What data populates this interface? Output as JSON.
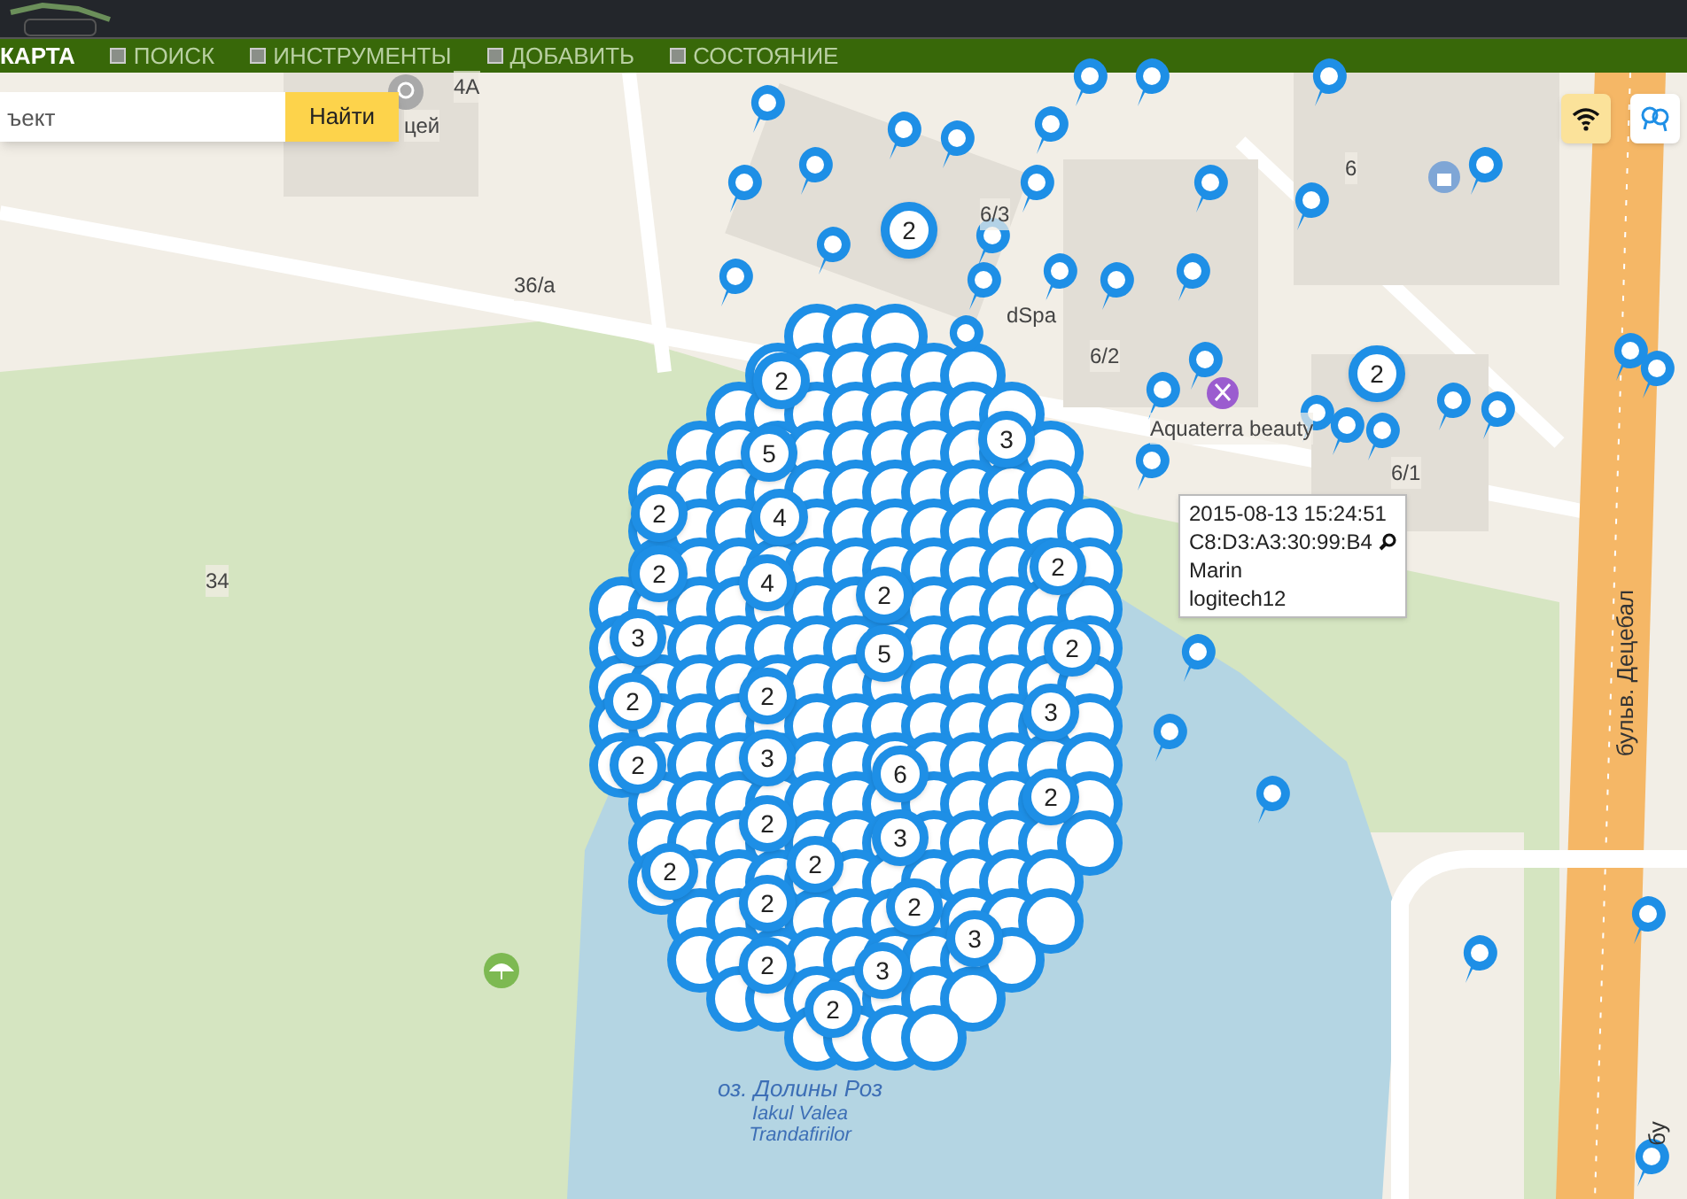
{
  "nav": [
    {
      "label": "КАРТА",
      "selected": true
    },
    {
      "label": "ПОИСК",
      "selected": false
    },
    {
      "label": "ИНСТРУМЕНТЫ",
      "selected": false
    },
    {
      "label": "ДОБАВИТЬ",
      "selected": false
    },
    {
      "label": "СОСТОЯНИЕ",
      "selected": false
    }
  ],
  "search": {
    "placeholder": "ъект",
    "button": "Найти"
  },
  "map_controls": [
    {
      "kind": "wifi",
      "selected": true
    },
    {
      "kind": "bubbles",
      "selected": false
    }
  ],
  "map_labels": [
    {
      "kind": "place",
      "text": "4A"
    },
    {
      "kind": "place",
      "text": "цей"
    },
    {
      "kind": "place",
      "text": "36/а"
    },
    {
      "kind": "place",
      "text": "34"
    },
    {
      "kind": "place",
      "text": "6"
    },
    {
      "kind": "place",
      "text": "6/3"
    },
    {
      "kind": "place",
      "text": "dSpa"
    },
    {
      "kind": "place",
      "text": "6/2"
    },
    {
      "kind": "place",
      "text": "6/1"
    },
    {
      "kind": "place",
      "text": "Aquaterra beauty"
    },
    {
      "kind": "street",
      "text": "бульв. Децебал"
    },
    {
      "kind": "street",
      "text": "бу"
    }
  ],
  "lake_label": {
    "name": "оз. Долины Роз",
    "lines": [
      "Iakul Valea",
      "Trandafirilor"
    ]
  },
  "clusters": [
    {
      "count": "2"
    },
    {
      "count": "2"
    },
    {
      "count": "3"
    },
    {
      "count": "5"
    },
    {
      "count": "4"
    },
    {
      "count": "2"
    },
    {
      "count": "2"
    },
    {
      "count": "2"
    },
    {
      "count": "4"
    },
    {
      "count": "2"
    },
    {
      "count": "3"
    },
    {
      "count": "5"
    },
    {
      "count": "2"
    },
    {
      "count": "2"
    },
    {
      "count": "2"
    },
    {
      "count": "3"
    },
    {
      "count": "3"
    },
    {
      "count": "2"
    },
    {
      "count": "6"
    },
    {
      "count": "2"
    },
    {
      "count": "2"
    },
    {
      "count": "3"
    },
    {
      "count": "2"
    },
    {
      "count": "2"
    },
    {
      "count": "2"
    },
    {
      "count": "2"
    },
    {
      "count": "3"
    },
    {
      "count": "2"
    },
    {
      "count": "3"
    },
    {
      "count": "2"
    },
    {
      "count": "2"
    }
  ],
  "tooltip": {
    "time": "2015-08-13 15:24:51",
    "mac": "C8:D3:A3:30:99:B4",
    "name": "Marin",
    "device": "logitech12"
  }
}
